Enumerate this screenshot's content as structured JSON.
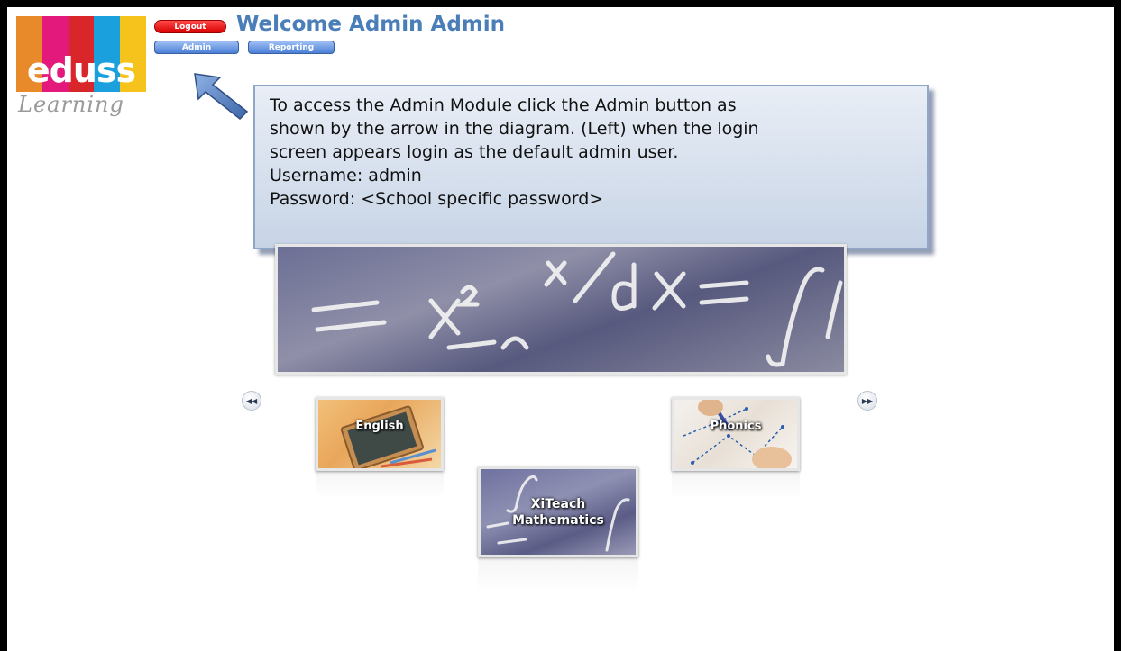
{
  "header": {
    "welcome": "Welcome Admin Admin",
    "logout_label": "Logout",
    "admin_label": "Admin",
    "reporting_label": "Reporting"
  },
  "logo": {
    "word": "eduss",
    "script": "Learning",
    "bar_colors": [
      "#e8892a",
      "#e3197b",
      "#d9262b",
      "#1aa0dd",
      "#f5c31b"
    ]
  },
  "callout": {
    "lines": [
      "To access the Admin Module click the Admin button as",
      "shown by the arrow in the diagram. (Left) when the login",
      "screen appears login as the default admin user.",
      "Username: admin",
      "Password: <School specific password>"
    ]
  },
  "carousel": {
    "prev_icon": "rewind-icon",
    "next_icon": "fast-forward-icon",
    "tiles": [
      {
        "label": "English"
      },
      {
        "label": "Phonics"
      },
      {
        "label_line1": "XiTeach",
        "label_line2": "Mathematics"
      }
    ]
  },
  "colors": {
    "welcome": "#4a7eb8",
    "logout": "#e00000",
    "nav_button": "#4a7fd6",
    "callout_bg": "#d3deec",
    "arrow": "#4a78b8"
  }
}
